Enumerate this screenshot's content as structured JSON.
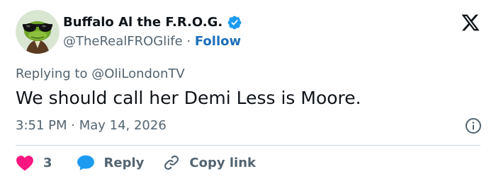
{
  "author": {
    "display_name": "Buffalo Al the F.R.O.G.",
    "handle": "@TheRealFROGlife",
    "separator": " · ",
    "follow_label": "Follow",
    "verified": true
  },
  "reply_context": "Replying to @OliLondonTV",
  "tweet_text": "We should call her Demi Less is Moore.",
  "timestamp": "3:51 PM · May 14, 2026",
  "actions": {
    "like_count": "3",
    "reply_label": "Reply",
    "copy_label": "Copy link"
  },
  "icons": {
    "logo": "x-logo-icon",
    "verified": "verified-badge-icon",
    "info": "info-icon",
    "like": "heart-icon",
    "reply": "speech-bubble-icon",
    "copy": "link-icon"
  },
  "colors": {
    "text": "#0f1419",
    "secondary": "#536471",
    "link": "#1d6fb8",
    "verified": "#1d9bf0",
    "like": "#f91880",
    "reply": "#1d9bf0",
    "divider": "#cfd9de"
  }
}
